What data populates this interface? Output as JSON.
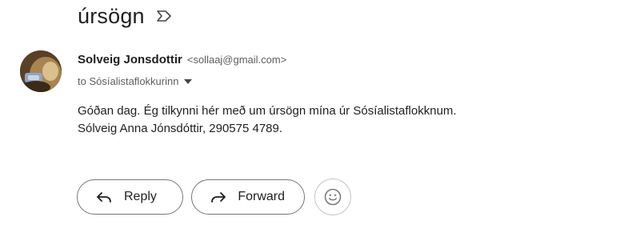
{
  "email": {
    "subject": "úrsögn",
    "label_icon": "label-arrow-icon",
    "sender": {
      "name": "Solveig Jonsdottir",
      "email": "<sollaaj@gmail.com>"
    },
    "recipient_line": "to Sósíalistaflokkurinn",
    "body_lines": [
      "Góðan dag. Ég tilkynni hér með um úrsögn mína úr Sósíalistaflokknum.",
      "Sólveig Anna Jónsdóttir, 290575 4789."
    ]
  },
  "actions": {
    "reply_label": "Reply",
    "reply_icon": "reply-arrow-icon",
    "forward_label": "Forward",
    "forward_icon": "forward-arrow-icon",
    "emoji_icon": "smiley-icon"
  },
  "colors": {
    "text_primary": "#1f1f1f",
    "text_secondary": "#5e5e5e",
    "button_border": "#747775"
  }
}
